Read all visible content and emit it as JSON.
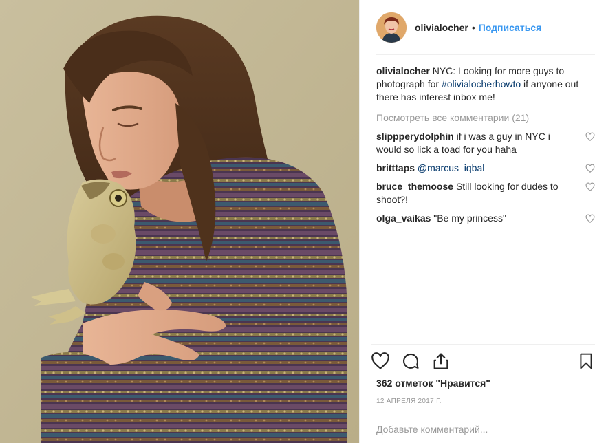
{
  "post": {
    "author": "olivialocher",
    "separator": "•",
    "follow_label": "Подписаться",
    "caption": {
      "username": "olivialocher",
      "text_before": "NYC: Looking for more guys to photograph for",
      "hashtag": "#olivialocherhowto",
      "text_after": "if anyone out there has interest inbox me!"
    },
    "view_all_comments": "Посмотреть все комментарии (21)",
    "comments": [
      {
        "username": "slippperydolphin",
        "text": "if i was a guy in NYC i would so lick a toad for you haha"
      },
      {
        "username": "britttaps",
        "mention": "@marcus_iqbal"
      },
      {
        "username": "bruce_themoose",
        "text": "Still looking for dudes to shoot?!"
      },
      {
        "username": "olga_vaikas",
        "text": "\"Be my princess\""
      }
    ],
    "likes": "362 отметок \"Нравится\"",
    "date": "12 АПРЕЛЯ 2017 Г.",
    "add_comment_placeholder": "Добавьте комментарий..."
  },
  "icons": {
    "like": "heart-icon",
    "comment": "comment-bubble-icon",
    "share": "share-icon",
    "save": "bookmark-icon",
    "comment_like": "small-heart-icon"
  },
  "colors": {
    "link": "#3897f0",
    "hashtag": "#003569",
    "muted": "#999999",
    "text": "#262626",
    "photo_background": "#c2b794"
  }
}
